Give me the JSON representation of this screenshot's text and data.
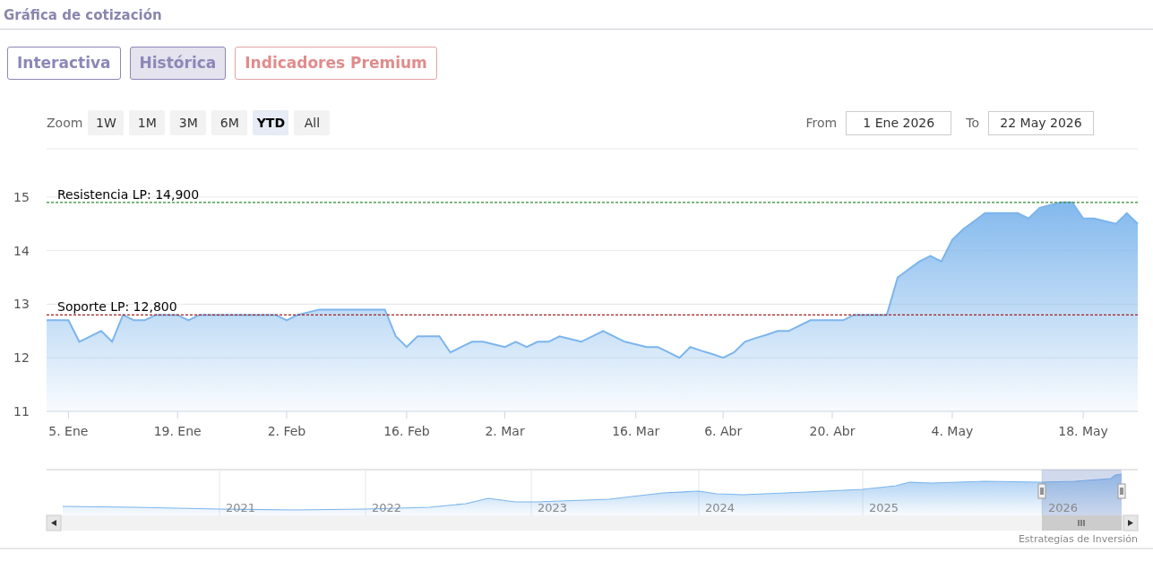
{
  "section": {
    "title": "Gráfica de cotización"
  },
  "views": [
    {
      "label": "Interactiva",
      "selected": false,
      "kind": "plain"
    },
    {
      "label": "Histórica",
      "selected": true,
      "kind": "plain"
    },
    {
      "label": "Indicadores Premium",
      "selected": false,
      "kind": "premium"
    }
  ],
  "range_selector": {
    "zoom_label": "Zoom",
    "buttons": [
      {
        "label": "1W",
        "selected": false
      },
      {
        "label": "1M",
        "selected": false
      },
      {
        "label": "3M",
        "selected": false
      },
      {
        "label": "6M",
        "selected": false
      },
      {
        "label": "YTD",
        "selected": true
      },
      {
        "label": "All",
        "selected": false
      }
    ],
    "from_label": "From",
    "from_value": "1 Ene 2026",
    "to_label": "To",
    "to_value": "22 May 2026"
  },
  "chart": {
    "chart_data": {
      "type": "area",
      "grid": true,
      "ylim": [
        11,
        15.9
      ],
      "yticks": [
        11,
        12,
        13,
        14,
        15
      ],
      "categories": [
        null,
        null,
        "5. Ene",
        null,
        null,
        null,
        null,
        null,
        null,
        null,
        null,
        null,
        "19. Ene",
        null,
        null,
        null,
        null,
        null,
        null,
        null,
        null,
        null,
        "2. Feb",
        null,
        null,
        null,
        null,
        null,
        null,
        null,
        null,
        null,
        null,
        "16. Feb",
        null,
        null,
        null,
        null,
        null,
        null,
        null,
        null,
        "2. Mar",
        null,
        null,
        null,
        null,
        null,
        null,
        null,
        null,
        null,
        null,
        null,
        "16. Mar",
        null,
        null,
        null,
        null,
        null,
        null,
        null,
        "6. Abr",
        null,
        null,
        null,
        null,
        null,
        null,
        null,
        null,
        null,
        "20. Abr",
        null,
        null,
        null,
        null,
        null,
        null,
        null,
        null,
        null,
        null,
        "4. May",
        null,
        null,
        null,
        null,
        null,
        null,
        null,
        null,
        null,
        null,
        null,
        "18. May",
        null,
        null,
        null,
        null,
        null
      ],
      "series": [
        {
          "color": "#7cb5ec",
          "values": [
            12.7,
            12.7,
            12.7,
            12.3,
            12.4,
            12.5,
            12.3,
            12.8,
            12.7,
            12.7,
            12.8,
            12.8,
            12.8,
            12.7,
            12.8,
            12.8,
            12.8,
            12.8,
            12.8,
            12.8,
            12.8,
            12.8,
            12.7,
            12.8,
            12.85,
            12.9,
            12.9,
            12.9,
            12.9,
            12.9,
            12.9,
            12.9,
            12.4,
            12.2,
            12.4,
            12.4,
            12.4,
            12.1,
            12.2,
            12.3,
            12.3,
            12.25,
            12.2,
            12.3,
            12.2,
            12.3,
            12.3,
            12.4,
            12.35,
            12.3,
            12.4,
            12.5,
            12.4,
            12.3,
            12.25,
            12.2,
            12.2,
            12.1,
            12.0,
            12.2,
            12.13,
            12.07,
            12.0,
            12.1,
            12.3,
            12.37,
            12.43,
            12.5,
            12.5,
            12.6,
            12.7,
            12.7,
            12.7,
            12.7,
            12.8,
            12.8,
            12.8,
            12.8,
            13.5,
            13.65,
            13.8,
            13.9,
            13.8,
            14.2,
            14.4,
            14.55,
            14.7,
            14.7,
            14.7,
            14.7,
            14.6,
            14.8,
            14.85,
            14.9,
            14.9,
            14.6,
            14.6,
            14.55,
            14.5,
            14.7,
            14.5
          ]
        }
      ],
      "ref_lines": [
        {
          "axis": "y",
          "value": 14.9,
          "label": "Resistencia LP: 14,900",
          "color": "#2e8b2e"
        },
        {
          "axis": "y",
          "value": 12.8,
          "label": "Soporte LP: 12,800",
          "color": "#a02020"
        }
      ]
    }
  },
  "navigator": {
    "years": [
      "2021",
      "2022",
      "2023",
      "2024",
      "2025",
      "2026"
    ]
  },
  "credit": "Estrategias de Inversión"
}
